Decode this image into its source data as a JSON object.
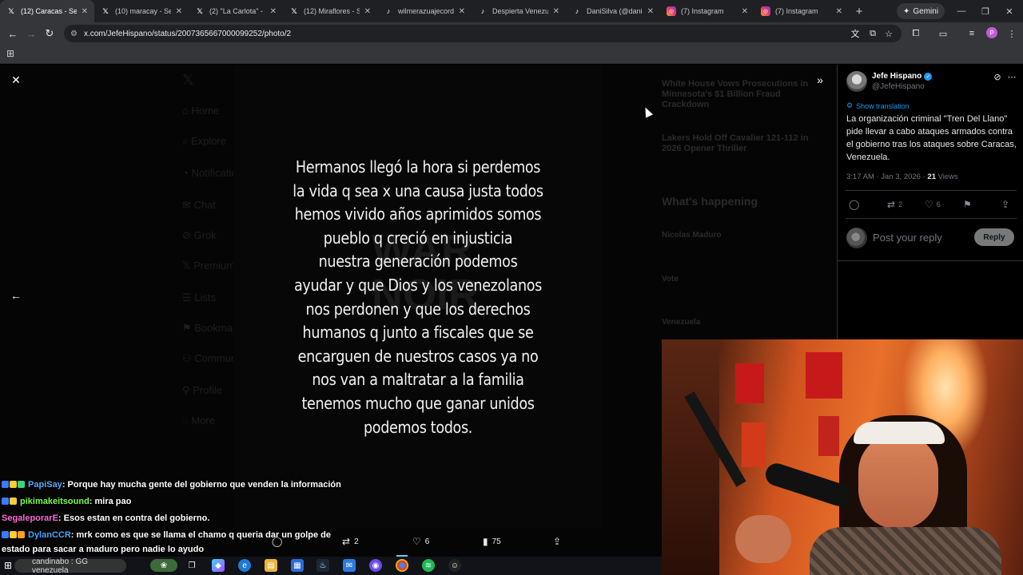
{
  "browser": {
    "tabs": [
      {
        "title": "(12) Caracas - Search",
        "favicon": "x-logo-icon",
        "active": true
      },
      {
        "title": "(10) maracay - Search",
        "favicon": "x-logo-icon",
        "active": false
      },
      {
        "title": "(2) \"La Carlota\" - Search",
        "favicon": "x-logo-icon",
        "active": false
      },
      {
        "title": "(12) Miraflores - Search",
        "favicon": "x-logo-icon",
        "active": false
      },
      {
        "title": "wilmerazuajecordero",
        "favicon": "tiktok-icon",
        "active": false
      },
      {
        "title": "Despierta Venezuela",
        "favicon": "tiktok-icon",
        "active": false
      },
      {
        "title": "DaniSilva (@danisilva)",
        "favicon": "tiktok-icon",
        "active": false
      },
      {
        "title": "(7) Instagram",
        "favicon": "instagram-icon",
        "active": false
      },
      {
        "title": "(7) Instagram",
        "favicon": "instagram-icon",
        "active": false
      }
    ],
    "gemini_label": "Gemini",
    "url": "x.com/JefeHispano/status/2007365667000099252/photo/2",
    "profile_initial": "P"
  },
  "background_timeline": {
    "nav_items": [
      "Home",
      "Explore",
      "Notifications",
      "Chat",
      "Grok",
      "Premium",
      "Lists",
      "Bookmarks",
      "Communities",
      "Profile",
      "More"
    ],
    "trends": [
      "White House Vows Prosecutions in Minnesota's $1 Billion Fraud Crackdown",
      "Lakers Hold Off Cavalier 121-112 in 2026 Opener Thriller",
      "What's happening",
      "Nicolas Maduro",
      "Vote",
      "Venezuela"
    ]
  },
  "photo": {
    "text": "Hermanos llegó la hora si perdemos la vida q sea x una causa justa todos hemos vivido años aprimidos somos pueblo q creció en injusticia nuestra generación podemos ayudar y que Dios y los venezolanos nos perdonen y que los derechos humanos q junto a fiscales que se encarguen de nuestros casos ya no nos van a maltratar a la familia tenemos mucho que ganar unidos podemos todos.",
    "lines": [
      "Hermanos llegó la hora si perdemos",
      "la vida q sea x una causa justa todos",
      "hemos vivido años aprimidos somos",
      "pueblo q creció en injusticia",
      "nuestra generación podemos",
      "ayudar y que Dios y los venezolanos",
      "nos perdonen y que los derechos",
      "humanos q junto a fiscales que se",
      "encarguen de nuestros casos ya no",
      "nos van a maltratar a la familia",
      "tenemos mucho que ganar unidos",
      "podemos todos."
    ],
    "watermark": "WAR NOIR",
    "actions": {
      "retweets": "2",
      "likes": "6",
      "views": "75"
    }
  },
  "tweet": {
    "display_name": "Jefe Hispano",
    "handle": "@JefeHispano",
    "show_translation": "Show translation",
    "text": "La organización criminal \"Tren Del Llano\" pide llevar a cabo ataques armados contra el gobierno tras los ataques sobre Caracas, Venezuela.",
    "time": "3:17 AM · Jan 3, 2026 · ",
    "views_count": "21",
    "views_label": " Views",
    "retweets": "2",
    "likes": "6",
    "reply_placeholder": "Post your reply",
    "reply_button": "Reply"
  },
  "chat": [
    {
      "user": "PapiSay",
      "color": "#5aa8ff",
      "message": ": Porque hay mucha gente del gobierno que venden la información"
    },
    {
      "user": "pikimakeitsound",
      "color": "#7cff4a",
      "message": ": mira pao"
    },
    {
      "user": "SegaleporarE",
      "color": "#ff6ad5",
      "message": ": Esos estan en contra del gobierno."
    },
    {
      "user": "DylanCCR",
      "color": "#4aa3ff",
      "message": ": mrk como es que se llama el chamo q queria dar un golpe de"
    },
    {
      "user": "",
      "color": "#ffffff",
      "message": "estado para sacar a maduro pero nadie lo ayudo"
    }
  ],
  "taskbar": {
    "search_text": "candinabo : GG venezuela"
  },
  "colors": {
    "x_blue": "#1d9bf0",
    "tab_bg": "#1f2023",
    "toolbar_bg": "#35363a"
  }
}
